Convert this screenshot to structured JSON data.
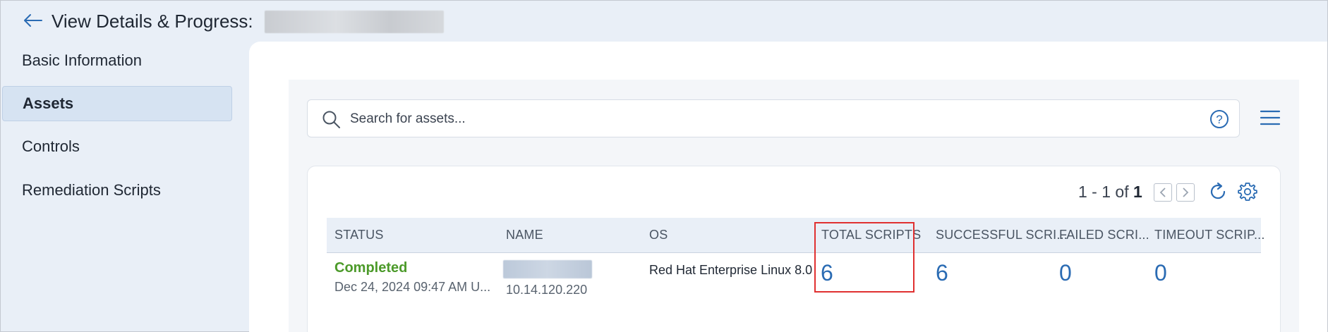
{
  "header": {
    "title": "View Details & Progress:"
  },
  "sidebar": {
    "items": [
      {
        "label": "Basic Information"
      },
      {
        "label": "Assets"
      },
      {
        "label": "Controls"
      },
      {
        "label": "Remediation Scripts"
      }
    ],
    "active": "Assets"
  },
  "search": {
    "placeholder": "Search for assets..."
  },
  "pager": {
    "range": "1 - 1 of",
    "total": "1"
  },
  "table": {
    "columns": [
      "STATUS",
      "NAME",
      "OS",
      "TOTAL SCRIPTS",
      "SUCCESSFUL SCRI...",
      "FAILED SCRI...",
      "TIMEOUT SCRIP..."
    ],
    "rows": [
      {
        "status": "Completed",
        "date": "Dec 24, 2024 09:47 AM U...",
        "ip": "10.14.120.220",
        "os": "Red Hat Enterprise Linux 8.0",
        "total_scripts": "6",
        "successful": "6",
        "failed": "0",
        "timeout": "0"
      }
    ]
  },
  "colors": {
    "accent": "#2a6bb3",
    "status_completed": "#4c9a2a",
    "highlight": "#e03030",
    "sidebar_active": "#d6e3f2"
  },
  "icons": [
    "back-arrow-icon",
    "search-icon",
    "help-icon",
    "hamburger-menu-icon",
    "chevron-left-icon",
    "chevron-right-icon",
    "refresh-icon",
    "gear-icon"
  ]
}
